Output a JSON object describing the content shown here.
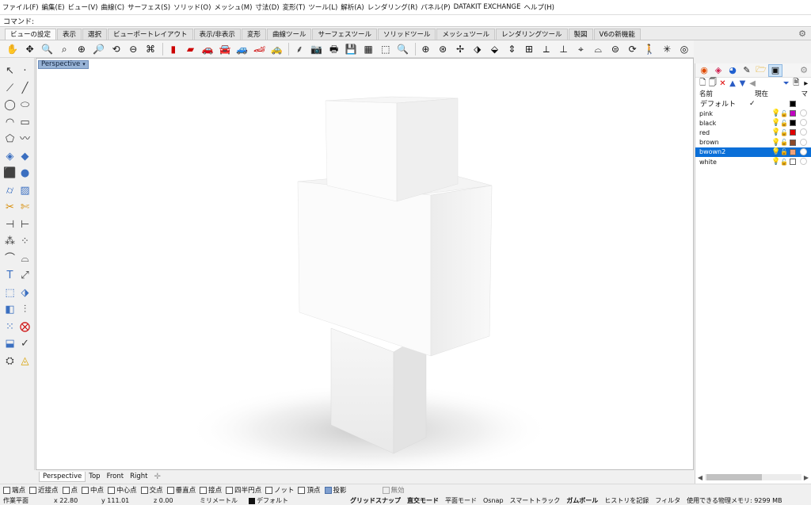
{
  "menu": [
    "ファイル(F)",
    "編集(E)",
    "ビュー(V)",
    "曲線(C)",
    "サーフェス(S)",
    "ソリッド(O)",
    "メッシュ(M)",
    "寸法(D)",
    "変形(T)",
    "ツール(L)",
    "解析(A)",
    "レンダリング(R)",
    "パネル(P)",
    "DATAKIT EXCHANGE",
    "ヘルプ(H)"
  ],
  "command": {
    "label": "コマンド:",
    "value": ""
  },
  "tabs": [
    "ビューの設定",
    "表示",
    "選択",
    "ビューポートレイアウト",
    "表示/非表示",
    "変形",
    "曲線ツール",
    "サーフェスツール",
    "ソリッドツール",
    "メッシュツール",
    "レンダリングツール",
    "製図",
    "V6の新機能"
  ],
  "active_tab": "ビューの設定",
  "viewport": {
    "label": "Perspective"
  },
  "viewport_tabs": [
    "Perspective",
    "Top",
    "Front",
    "Right"
  ],
  "layers_panel": {
    "header": {
      "name": "名前",
      "current": "現在",
      "material": "マ"
    },
    "default_layer": {
      "name": "デフォルト",
      "current_mark": "✓",
      "color": "#000000"
    },
    "layers": [
      {
        "name": "pink",
        "color": "#c000c0"
      },
      {
        "name": "black",
        "color": "#000000"
      },
      {
        "name": "red",
        "color": "#e00000"
      },
      {
        "name": "brown",
        "color": "#8b4a2b"
      },
      {
        "name": "bwown2",
        "color": "#f2a27a",
        "selected": true
      },
      {
        "name": "white",
        "color": "#ffffff"
      }
    ]
  },
  "osnap": [
    {
      "label": "端点",
      "checked": false
    },
    {
      "label": "近接点",
      "checked": false
    },
    {
      "label": "点",
      "checked": false
    },
    {
      "label": "中点",
      "checked": false
    },
    {
      "label": "中心点",
      "checked": false
    },
    {
      "label": "交点",
      "checked": false
    },
    {
      "label": "垂直点",
      "checked": false
    },
    {
      "label": "接点",
      "checked": false
    },
    {
      "label": "四半円点",
      "checked": false
    },
    {
      "label": "ノット",
      "checked": false
    },
    {
      "label": "頂点",
      "checked": false
    },
    {
      "label": "投影",
      "checked": true
    },
    {
      "label": "無効",
      "checked": false,
      "disabled": true
    }
  ],
  "status": {
    "cplane": "作業平面",
    "x": "x 22.80",
    "y": "y 111.01",
    "z": "z 0.00",
    "units": "ミリメートル",
    "layer": "デフォルト",
    "grid_snap": "グリッドスナップ",
    "ortho": "直交モード",
    "planar": "平面モード",
    "osnap": "Osnap",
    "smarttrack": "スマートトラック",
    "gumball": "ガムボール",
    "history": "ヒストリを記録",
    "filter": "フィルタ",
    "memory": "使用できる物理メモリ: 9299 MB"
  }
}
